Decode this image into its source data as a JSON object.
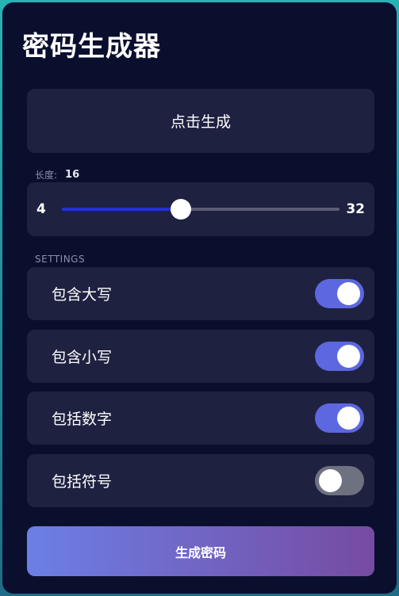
{
  "app": {
    "title": "密码生成器"
  },
  "display": {
    "text": "点击生成"
  },
  "length": {
    "label": "长度:",
    "value": "16",
    "min": "4",
    "max": "32",
    "current": 16
  },
  "settings": {
    "header": "SETTINGS",
    "options": [
      {
        "label": "包含大写",
        "enabled": true
      },
      {
        "label": "包含小写",
        "enabled": true
      },
      {
        "label": "包括数字",
        "enabled": true
      },
      {
        "label": "包括符号",
        "enabled": false
      }
    ]
  },
  "generate": {
    "label": "生成密码"
  },
  "colors": {
    "card_background": "#0b0f2e",
    "panel_background": "#1e2140",
    "toggle_on": "#5c67e0",
    "toggle_off": "#6e717f",
    "slider_fill": "#2430d8",
    "button_gradient_start": "#6c7fe6",
    "button_gradient_end": "#764ba2"
  }
}
